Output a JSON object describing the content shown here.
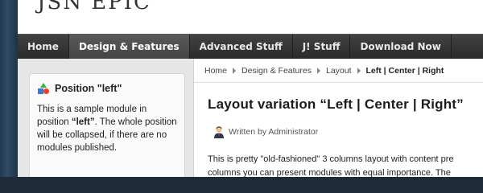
{
  "site": {
    "logo_text": "JSN EPIC"
  },
  "nav": {
    "items": [
      {
        "label": "Home"
      },
      {
        "label": "Design & Features"
      },
      {
        "label": "Advanced Stuff"
      },
      {
        "label": "J! Stuff"
      },
      {
        "label": "Download Now"
      }
    ],
    "active_index": 1
  },
  "left_module": {
    "title": "Position \"left\"",
    "body_pre": "This is a sample module in position ",
    "body_bold": "“left”",
    "body_post": ". The whole position will be collapsed, if there are no modules published."
  },
  "breadcrumb": {
    "items": [
      "Home",
      "Design & Features",
      "Layout",
      "Left | Center | Right"
    ]
  },
  "article": {
    "title": "Layout variation “Left | Center | Right”",
    "author": "Written by Administrator",
    "text_line1": "This is pretty \"old-fashioned\" 3 columns layout with content pre",
    "text_line2": "columns you can present modules with equal importance. The"
  },
  "colors": {
    "nav_bg": "#2f2f2f",
    "nav_active": "#4e4e4e",
    "left_col_bg": "#e6e6e6"
  }
}
